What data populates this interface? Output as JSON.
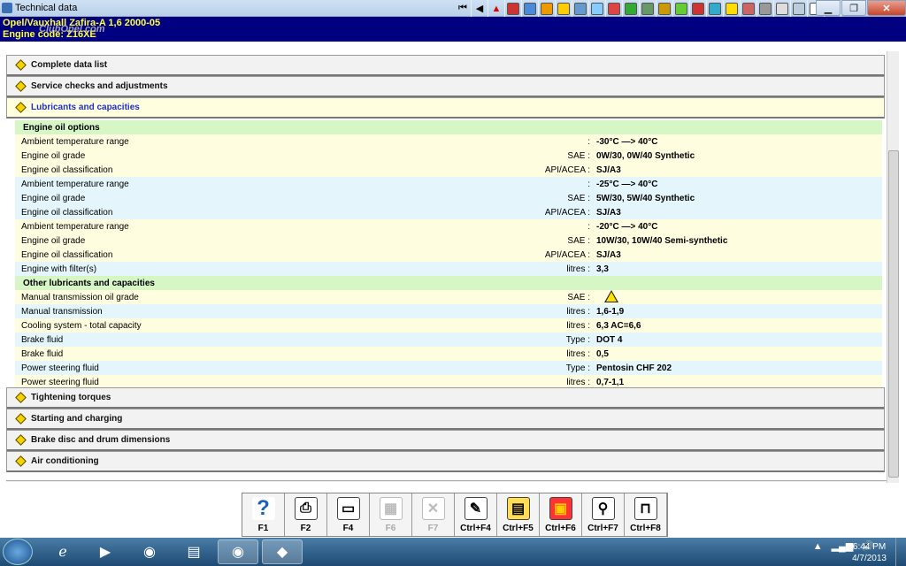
{
  "window": {
    "title": "Technical data"
  },
  "vehicle": {
    "line1": "Opel/Vauxhall  Zafira-A  1,6  2000-05",
    "line2": "Engine code: Z16XE",
    "watermark": "ClubOpel.com"
  },
  "sections_top": [
    {
      "label": "Complete data list"
    },
    {
      "label": "Service checks and adjustments"
    },
    {
      "label": "Lubricants and capacities"
    }
  ],
  "rows": [
    {
      "label": "Engine oil options",
      "unit": "",
      "value": "",
      "style": "g"
    },
    {
      "label": "Ambient temperature range",
      "unit": ":",
      "value": "-30°C —> 40°C",
      "style": "y"
    },
    {
      "label": "Engine oil grade",
      "unit": "SAE :",
      "value": "0W/30, 0W/40 Synthetic",
      "style": "y"
    },
    {
      "label": "Engine oil classification",
      "unit": "API/ACEA :",
      "value": "SJ/A3",
      "style": "y"
    },
    {
      "label": "Ambient temperature range",
      "unit": ":",
      "value": "-25°C —> 40°C",
      "style": "b"
    },
    {
      "label": "Engine oil grade",
      "unit": "SAE :",
      "value": "5W/30, 5W/40 Synthetic",
      "style": "b"
    },
    {
      "label": "Engine oil classification",
      "unit": "API/ACEA :",
      "value": "SJ/A3",
      "style": "b"
    },
    {
      "label": "Ambient temperature range",
      "unit": ":",
      "value": "-20°C —> 40°C",
      "style": "y"
    },
    {
      "label": "Engine oil grade",
      "unit": "SAE :",
      "value": "10W/30, 10W/40 Semi-synthetic",
      "style": "y"
    },
    {
      "label": "Engine oil classification",
      "unit": "API/ACEA :",
      "value": "SJ/A3",
      "style": "y"
    },
    {
      "label": "Engine with filter(s)",
      "unit": "litres :",
      "value": "3,3",
      "style": "b"
    },
    {
      "label": "Other lubricants and capacities",
      "unit": "",
      "value": "",
      "style": "g"
    },
    {
      "label": "Manual transmission oil grade",
      "unit": "SAE :",
      "value": "",
      "style": "y",
      "warning": true
    },
    {
      "label": "Manual transmission",
      "unit": "litres :",
      "value": "1,6-1,9",
      "style": "b"
    },
    {
      "label": "Cooling system - total capacity",
      "unit": "litres :",
      "value": "6,3 AC=6,6",
      "style": "y"
    },
    {
      "label": "Brake fluid",
      "unit": "Type :",
      "value": "DOT 4",
      "style": "b"
    },
    {
      "label": "Brake fluid",
      "unit": "litres :",
      "value": "0,5",
      "style": "y"
    },
    {
      "label": "Power steering fluid",
      "unit": "Type :",
      "value": "Pentosin CHF 202",
      "style": "b"
    },
    {
      "label": "Power steering fluid",
      "unit": "litres :",
      "value": "0,7-1,1",
      "style": "y"
    }
  ],
  "sections_bottom": [
    {
      "label": "Tightening torques"
    },
    {
      "label": "Starting and charging"
    },
    {
      "label": "Brake disc and drum dimensions"
    },
    {
      "label": "Air conditioning"
    }
  ],
  "fkeys": [
    {
      "label": "F1",
      "icon": "help-icon",
      "glyph": "?",
      "enabled": true
    },
    {
      "label": "F2",
      "icon": "print-icon",
      "glyph": "⎙",
      "enabled": true
    },
    {
      "label": "F4",
      "icon": "screen-icon",
      "glyph": "▭",
      "enabled": true
    },
    {
      "label": "F6",
      "icon": "data-icon",
      "glyph": "▦",
      "enabled": false
    },
    {
      "label": "F7",
      "icon": "tools-icon",
      "glyph": "✕",
      "enabled": false
    },
    {
      "label": "Ctrl+F4",
      "icon": "notes-icon",
      "glyph": "✎",
      "enabled": true
    },
    {
      "label": "Ctrl+F5",
      "icon": "manual-icon",
      "glyph": "▤",
      "enabled": true
    },
    {
      "label": "Ctrl+F6",
      "icon": "calendar-icon",
      "glyph": "▣",
      "enabled": true
    },
    {
      "label": "Ctrl+F7",
      "icon": "search-icon",
      "glyph": "⚲",
      "enabled": true
    },
    {
      "label": "Ctrl+F8",
      "icon": "lift-icon",
      "glyph": "⊓",
      "enabled": true
    }
  ],
  "clock": {
    "time": "6:44 PM",
    "date": "4/7/2013"
  }
}
